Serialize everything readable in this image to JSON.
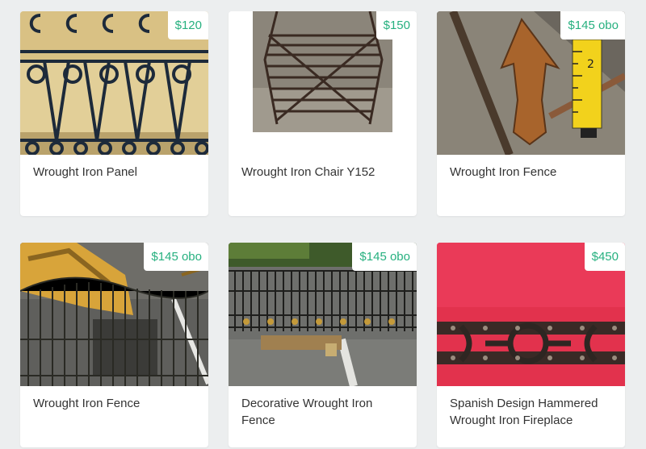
{
  "listings": [
    {
      "title": "Wrought Iron Panel",
      "price": "$120",
      "image": "wrought-iron-panel-photo"
    },
    {
      "title": "Wrought Iron Chair Y152",
      "price": "$150",
      "image": "wrought-iron-chair-photo"
    },
    {
      "title": "Wrought Iron Fence",
      "price": "$145 obo",
      "image": "fence-finial-photo"
    },
    {
      "title": "Wrought Iron Fence",
      "price": "$145 obo",
      "image": "fence-parking-lot-photo"
    },
    {
      "title": "Decorative Wrought Iron Fence",
      "price": "$145 obo",
      "image": "decorative-fence-photo"
    },
    {
      "title": "Spanish Design Hammered Wrought Iron Fireplace",
      "price": "$450",
      "image": "fireplace-screen-photo"
    }
  ],
  "colors": {
    "price": "#26b07f",
    "background": "#eceeef",
    "card": "#ffffff",
    "title": "#333333"
  }
}
